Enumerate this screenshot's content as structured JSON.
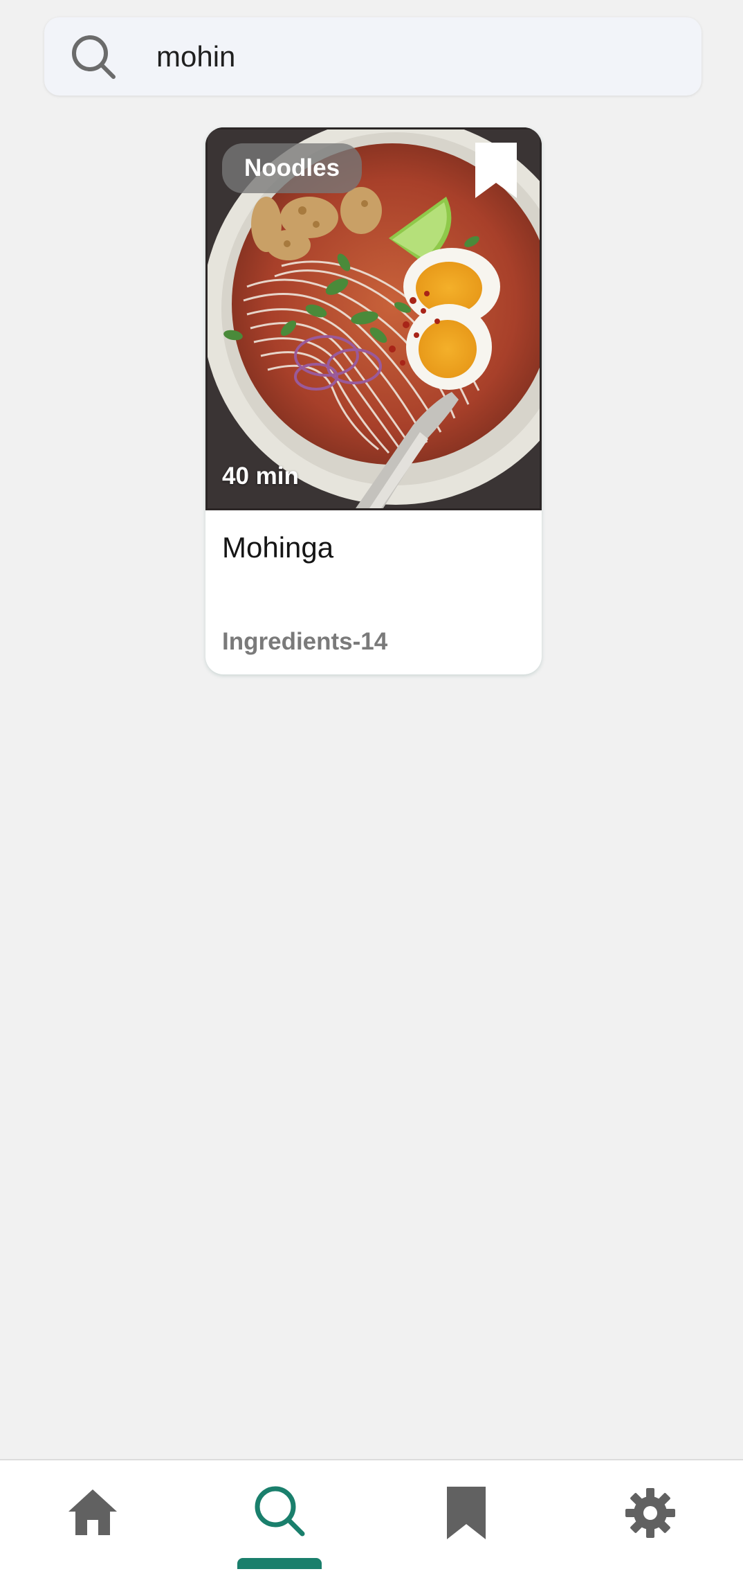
{
  "search": {
    "value": "mohin",
    "icon": "search-icon"
  },
  "results": [
    {
      "category": "Noodles",
      "time": "40 min",
      "title": "Mohinga",
      "ingredients": "Ingredients-14",
      "bookmark_icon": "bookmark-icon"
    }
  ],
  "bottom_nav": {
    "items": [
      {
        "icon": "home-icon",
        "active": false
      },
      {
        "icon": "search-icon",
        "active": true
      },
      {
        "icon": "bookmark-icon",
        "active": false
      },
      {
        "icon": "gear-icon",
        "active": false
      }
    ]
  },
  "colors": {
    "accent": "#1a7f6c",
    "icon_inactive": "#616161",
    "background": "#f1f1f1"
  }
}
